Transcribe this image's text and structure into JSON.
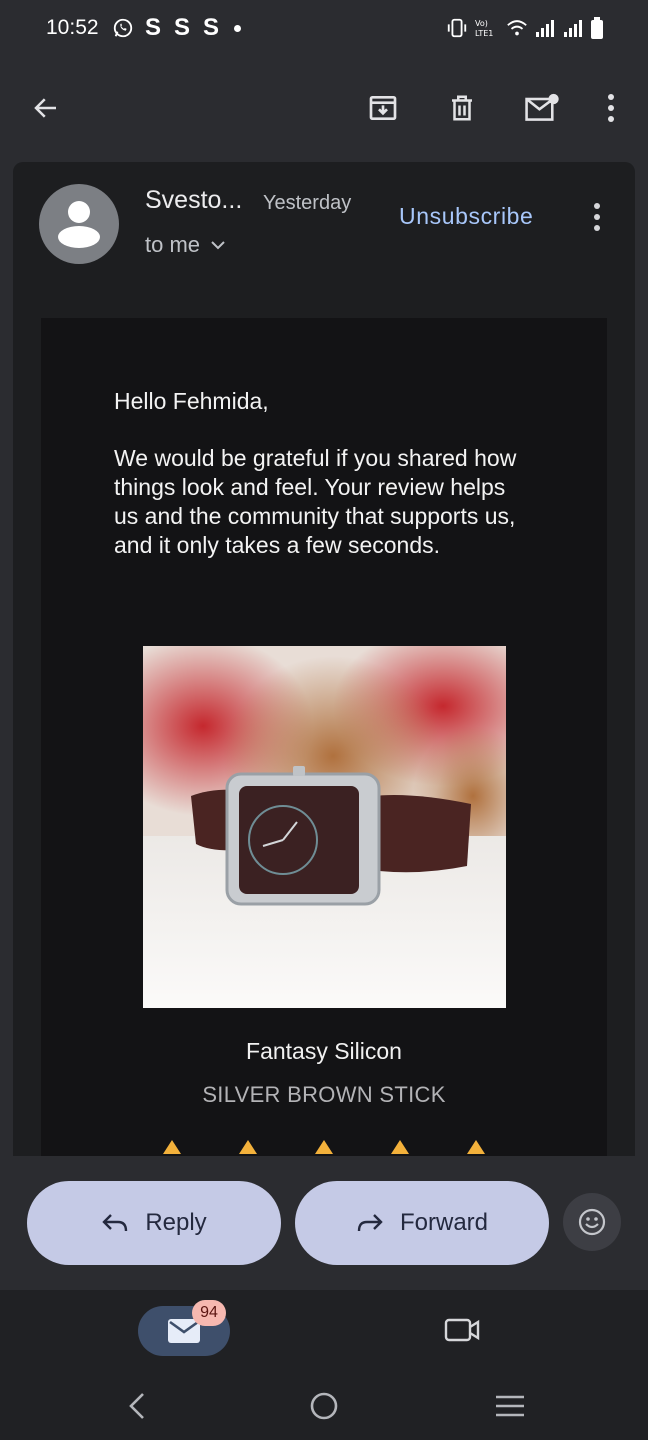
{
  "status_bar": {
    "time": "10:52",
    "notification_s_1": "S",
    "notification_s_2": "S",
    "notification_s_3": "S",
    "volte_label": "Vo) LTE1",
    "icons": [
      "whatsapp-icon",
      "vibrate-icon",
      "volte-icon",
      "wifi-icon",
      "signal-icon",
      "signal-icon",
      "battery-icon"
    ]
  },
  "toolbar": {
    "icons": [
      "back-arrow-icon",
      "archive-icon",
      "delete-icon",
      "mark-unread-icon",
      "more-vert-icon"
    ]
  },
  "email": {
    "sender": "Svesto...",
    "date": "Yesterday",
    "recipient": "to me",
    "unsubscribe": "Unsubscribe",
    "greeting": "Hello Fehmida,",
    "body": "We would be grateful if you shared how things look and feel. Your review helps us and the community that supports us, and it only takes a few seconds.",
    "product": {
      "name": "Fantasy Silicon",
      "variant": "SILVER BROWN STICK"
    }
  },
  "actions": {
    "reply": "Reply",
    "forward": "Forward"
  },
  "bottom_nav": {
    "mail_badge": "94"
  },
  "colors": {
    "background": "#2b2c30",
    "card": "#1d1e20",
    "link": "#a8c7fa",
    "pill": "#c5cae6",
    "badge": "#f6b8b0",
    "star": "#f3b13b"
  }
}
